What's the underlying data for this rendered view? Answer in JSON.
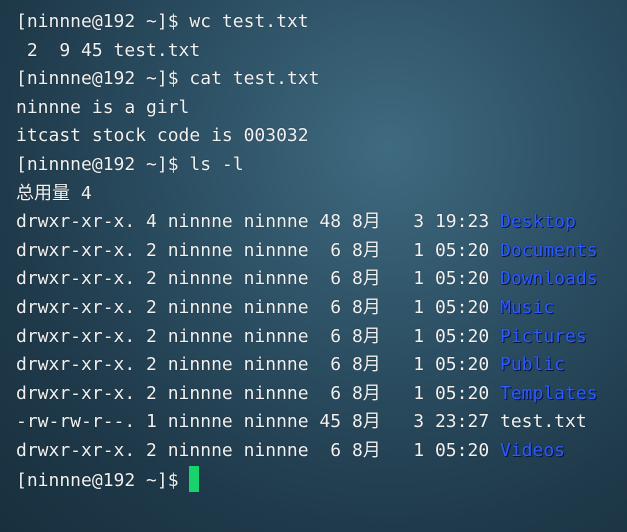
{
  "terminal": {
    "prompt": "[ninnne@192 ~]$",
    "lines": [
      {
        "kind": "prompt",
        "command": "wc test.txt"
      },
      {
        "kind": "output",
        "text": " 2  9 45 test.txt"
      },
      {
        "kind": "prompt",
        "command": "cat test.txt"
      },
      {
        "kind": "output",
        "text": "ninnne is a girl"
      },
      {
        "kind": "output",
        "text": "itcast stock code is 003032"
      },
      {
        "kind": "prompt",
        "command": "ls -l"
      },
      {
        "kind": "output",
        "text": "总用量 4"
      }
    ],
    "listing": [
      {
        "meta": "drwxr-xr-x. 4 ninnne ninnne 48 8月   3 19:23",
        "name": "Desktop",
        "is_dir": true
      },
      {
        "meta": "drwxr-xr-x. 2 ninnne ninnne  6 8月   1 05:20",
        "name": "Documents",
        "is_dir": true
      },
      {
        "meta": "drwxr-xr-x. 2 ninnne ninnne  6 8月   1 05:20",
        "name": "Downloads",
        "is_dir": true
      },
      {
        "meta": "drwxr-xr-x. 2 ninnne ninnne  6 8月   1 05:20",
        "name": "Music",
        "is_dir": true
      },
      {
        "meta": "drwxr-xr-x. 2 ninnne ninnne  6 8月   1 05:20",
        "name": "Pictures",
        "is_dir": true
      },
      {
        "meta": "drwxr-xr-x. 2 ninnne ninnne  6 8月   1 05:20",
        "name": "Public",
        "is_dir": true
      },
      {
        "meta": "drwxr-xr-x. 2 ninnne ninnne  6 8月   1 05:20",
        "name": "Templates",
        "is_dir": true
      },
      {
        "meta": "-rw-rw-r--. 1 ninnne ninnne 45 8月   3 23:27",
        "name": "test.txt",
        "is_dir": false
      },
      {
        "meta": "drwxr-xr-x. 2 ninnne ninnne  6 8月   1 05:20",
        "name": "Videos",
        "is_dir": true
      }
    ],
    "final_prompt": "[ninnne@192 ~]$",
    "colors": {
      "text": "#f2f2f2",
      "directory": "#2b5cff",
      "cursor": "#16d46b",
      "background": "#2c4f63"
    }
  }
}
